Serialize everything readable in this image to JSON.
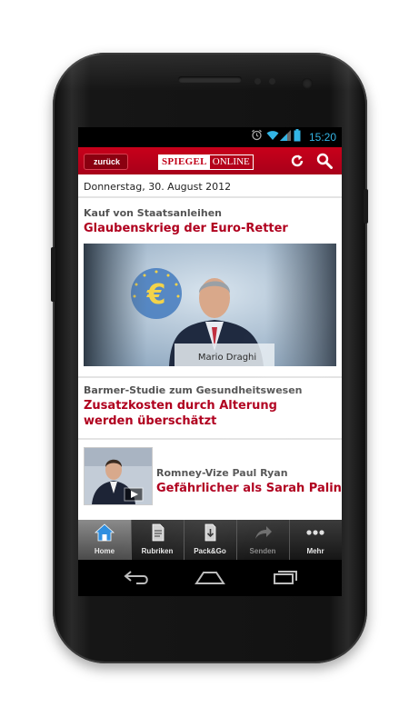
{
  "status_bar": {
    "time": "15:20",
    "icons": [
      "alarm-icon",
      "wifi-icon",
      "signal-icon",
      "battery-icon"
    ]
  },
  "app_bar": {
    "back_label": "zurück",
    "logo_part1": "SPIEGEL",
    "logo_part2": "ONLINE",
    "icons": [
      "refresh-icon",
      "search-icon"
    ],
    "color": "#c8001a"
  },
  "content": {
    "date": "Donnerstag, 30. August 2012",
    "articles": [
      {
        "kicker": "Kauf von Staatsanleihen",
        "headline": "Glaubenskrieg der Euro-Retter",
        "image_caption": "Mario Draghi"
      },
      {
        "kicker": "Barmer-Studie zum Gesundheitswesen",
        "headline": "Zusatzkosten durch Alterung werden überschätzt"
      },
      {
        "kicker": "Romney-Vize Paul Ryan",
        "headline": "Gefährlicher als Sarah Palin",
        "has_video": true
      }
    ]
  },
  "bottom_tabs": [
    {
      "label": "Home",
      "icon": "home-icon",
      "active": true
    },
    {
      "label": "Rubriken",
      "icon": "document-icon",
      "active": false
    },
    {
      "label": "Pack&Go",
      "icon": "download-icon",
      "active": false
    },
    {
      "label": "Senden",
      "icon": "share-icon",
      "active": false,
      "disabled": true
    },
    {
      "label": "Mehr",
      "icon": "more-icon",
      "active": false
    }
  ],
  "system_nav": [
    "back-icon",
    "home-nav-icon",
    "recent-apps-icon"
  ],
  "colors": {
    "headline": "#b0001e",
    "kicker": "#555555",
    "accent_blue": "#33b5e5"
  }
}
